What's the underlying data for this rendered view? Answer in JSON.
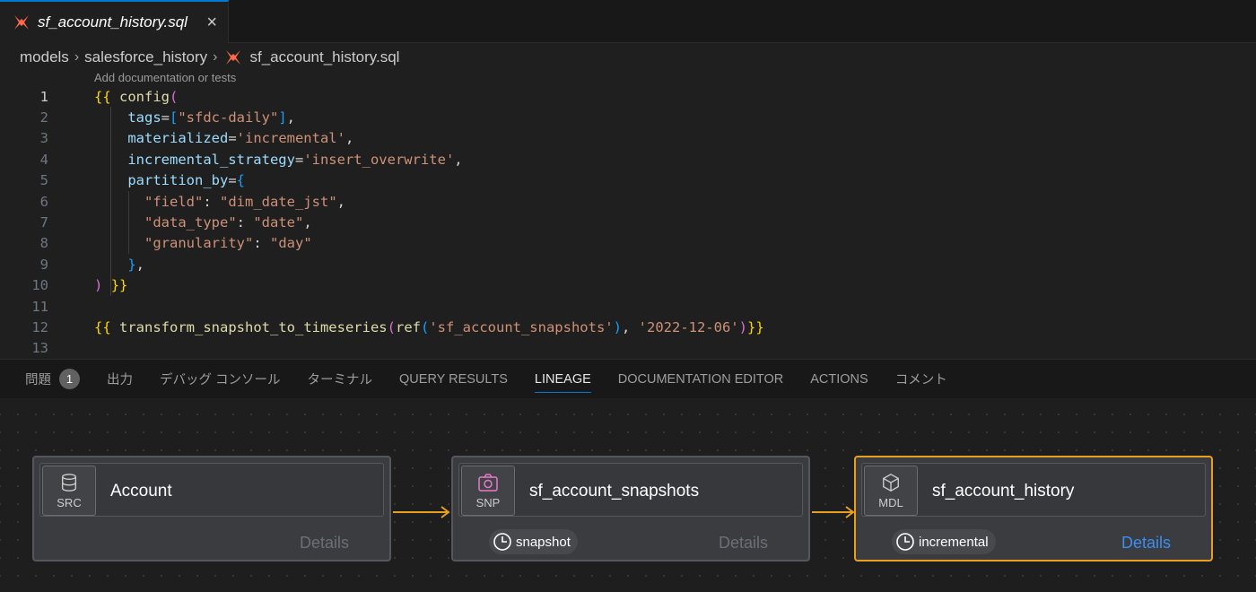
{
  "tab": {
    "title": "sf_account_history.sql",
    "close": "×"
  },
  "breadcrumb": {
    "items": [
      "models",
      "salesforce_history",
      "sf_account_history.sql"
    ],
    "separator": "›"
  },
  "codelens": "Add documentation or tests",
  "editor": {
    "line_numbers": [
      "1",
      "2",
      "3",
      "4",
      "5",
      "6",
      "7",
      "8",
      "9",
      "10",
      "11",
      "12",
      "13"
    ],
    "active_line": "1",
    "lines": [
      [
        {
          "c": "y",
          "t": "{{"
        },
        {
          "c": "t",
          "t": " "
        },
        {
          "c": "f",
          "t": "config"
        },
        {
          "c": "p",
          "t": "("
        }
      ],
      [
        {
          "c": "t",
          "t": "    "
        },
        {
          "c": "v",
          "t": "tags"
        },
        {
          "c": "t",
          "t": "="
        },
        {
          "c": "b",
          "t": "["
        },
        {
          "c": "s",
          "t": "\"sfdc-daily\""
        },
        {
          "c": "b",
          "t": "]"
        },
        {
          "c": "t",
          "t": ","
        }
      ],
      [
        {
          "c": "t",
          "t": "    "
        },
        {
          "c": "v",
          "t": "materialized"
        },
        {
          "c": "t",
          "t": "="
        },
        {
          "c": "s",
          "t": "'incremental'"
        },
        {
          "c": "t",
          "t": ","
        }
      ],
      [
        {
          "c": "t",
          "t": "    "
        },
        {
          "c": "v",
          "t": "incremental_strategy"
        },
        {
          "c": "t",
          "t": "="
        },
        {
          "c": "s",
          "t": "'insert_overwrite'"
        },
        {
          "c": "t",
          "t": ","
        }
      ],
      [
        {
          "c": "t",
          "t": "    "
        },
        {
          "c": "v",
          "t": "partition_by"
        },
        {
          "c": "t",
          "t": "="
        },
        {
          "c": "b",
          "t": "{"
        }
      ],
      [
        {
          "c": "t",
          "t": "      "
        },
        {
          "c": "s",
          "t": "\"field\""
        },
        {
          "c": "t",
          "t": ": "
        },
        {
          "c": "s",
          "t": "\"dim_date_jst\""
        },
        {
          "c": "t",
          "t": ","
        }
      ],
      [
        {
          "c": "t",
          "t": "      "
        },
        {
          "c": "s",
          "t": "\"data_type\""
        },
        {
          "c": "t",
          "t": ": "
        },
        {
          "c": "s",
          "t": "\"date\""
        },
        {
          "c": "t",
          "t": ","
        }
      ],
      [
        {
          "c": "t",
          "t": "      "
        },
        {
          "c": "s",
          "t": "\"granularity\""
        },
        {
          "c": "t",
          "t": ": "
        },
        {
          "c": "s",
          "t": "\"day\""
        }
      ],
      [
        {
          "c": "t",
          "t": "    "
        },
        {
          "c": "b",
          "t": "}"
        },
        {
          "c": "t",
          "t": ","
        }
      ],
      [
        {
          "c": "p",
          "t": ")"
        },
        {
          "c": "t",
          "t": " "
        },
        {
          "c": "y",
          "t": "}}"
        }
      ],
      [],
      [
        {
          "c": "y",
          "t": "{{"
        },
        {
          "c": "t",
          "t": " "
        },
        {
          "c": "f",
          "t": "transform_snapshot_to_timeseries"
        },
        {
          "c": "p",
          "t": "("
        },
        {
          "c": "f",
          "t": "ref"
        },
        {
          "c": "b",
          "t": "("
        },
        {
          "c": "s",
          "t": "'sf_account_snapshots'"
        },
        {
          "c": "b",
          "t": ")"
        },
        {
          "c": "t",
          "t": ", "
        },
        {
          "c": "s",
          "t": "'2022-12-06'"
        },
        {
          "c": "p",
          "t": ")"
        },
        {
          "c": "y",
          "t": "}}"
        }
      ],
      []
    ]
  },
  "panel": {
    "tabs": [
      {
        "label": "問題",
        "badge": "1"
      },
      {
        "label": "出力"
      },
      {
        "label": "デバッグ コンソール"
      },
      {
        "label": "ターミナル"
      },
      {
        "label": "QUERY RESULTS"
      },
      {
        "label": "LINEAGE",
        "active": true
      },
      {
        "label": "DOCUMENTATION EDITOR"
      },
      {
        "label": "ACTIONS"
      },
      {
        "label": "コメント"
      }
    ]
  },
  "lineage": {
    "nodes": [
      {
        "abbr": "SRC",
        "name": "Account",
        "icon": "database-icon",
        "pill": null,
        "details": "Details"
      },
      {
        "abbr": "SNP",
        "name": "sf_account_snapshots",
        "icon": "camera-icon",
        "pill": "snapshot",
        "details": "Details"
      },
      {
        "abbr": "MDL",
        "name": "sf_account_history",
        "icon": "cube-icon",
        "pill": "incremental",
        "details": "Details",
        "selected": true
      }
    ],
    "colors": {
      "accent": "#e8a020",
      "details_active": "#3b8ff0",
      "snp_icon": "#e879c9"
    }
  }
}
